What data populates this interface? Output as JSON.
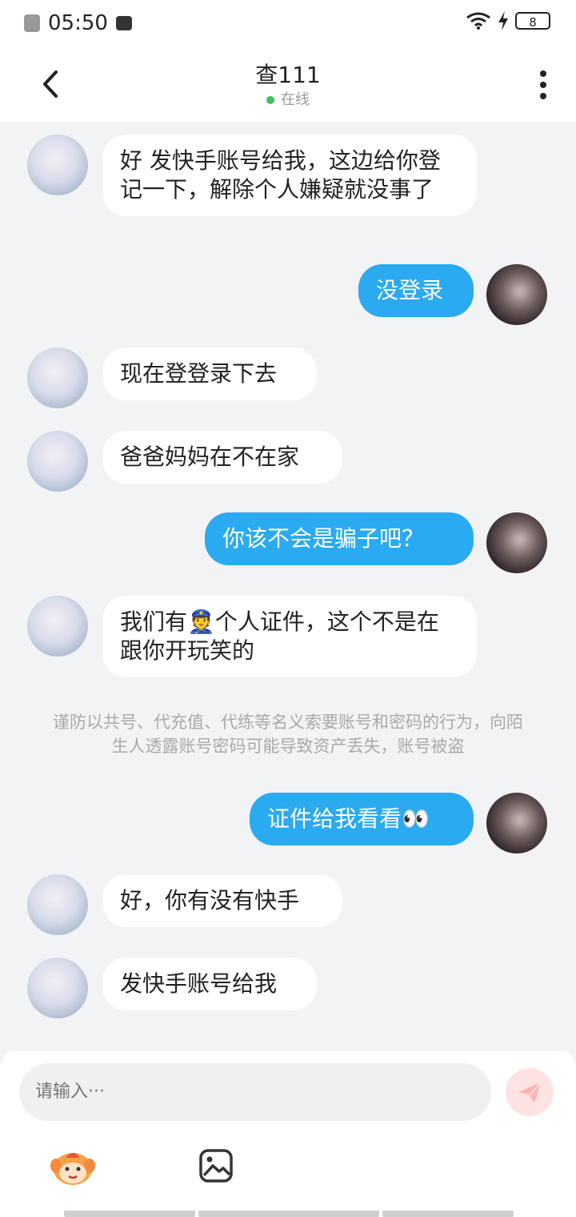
{
  "statusbar": {
    "time": "05:50",
    "battery": "8"
  },
  "header": {
    "title": "查111",
    "status": "在线"
  },
  "messages": [
    {
      "side": "left",
      "text": "好 发快手账号给我，这边给你登记一下，解除个人嫌疑就没事了"
    },
    {
      "side": "right",
      "text": "没登录"
    },
    {
      "side": "left",
      "text": "现在登登录下去"
    },
    {
      "side": "left",
      "text": "爸爸妈妈在不在家"
    },
    {
      "side": "right",
      "text": "你该不会是骗子吧？"
    },
    {
      "side": "left",
      "text": "我们有👮个人证件，这个不是在跟你开玩笑的"
    },
    {
      "side": "right",
      "text": "证件给我看看👀"
    },
    {
      "side": "left",
      "text": "好，你有没有快手"
    },
    {
      "side": "left",
      "text": "发快手账号给我"
    }
  ],
  "notice": "谨防以共号、代充值、代练等名义索要账号和密码的行为，向陌生人透露账号密码可能导致资产丢失，账号被盗",
  "composer": {
    "placeholder": "请输入···"
  }
}
